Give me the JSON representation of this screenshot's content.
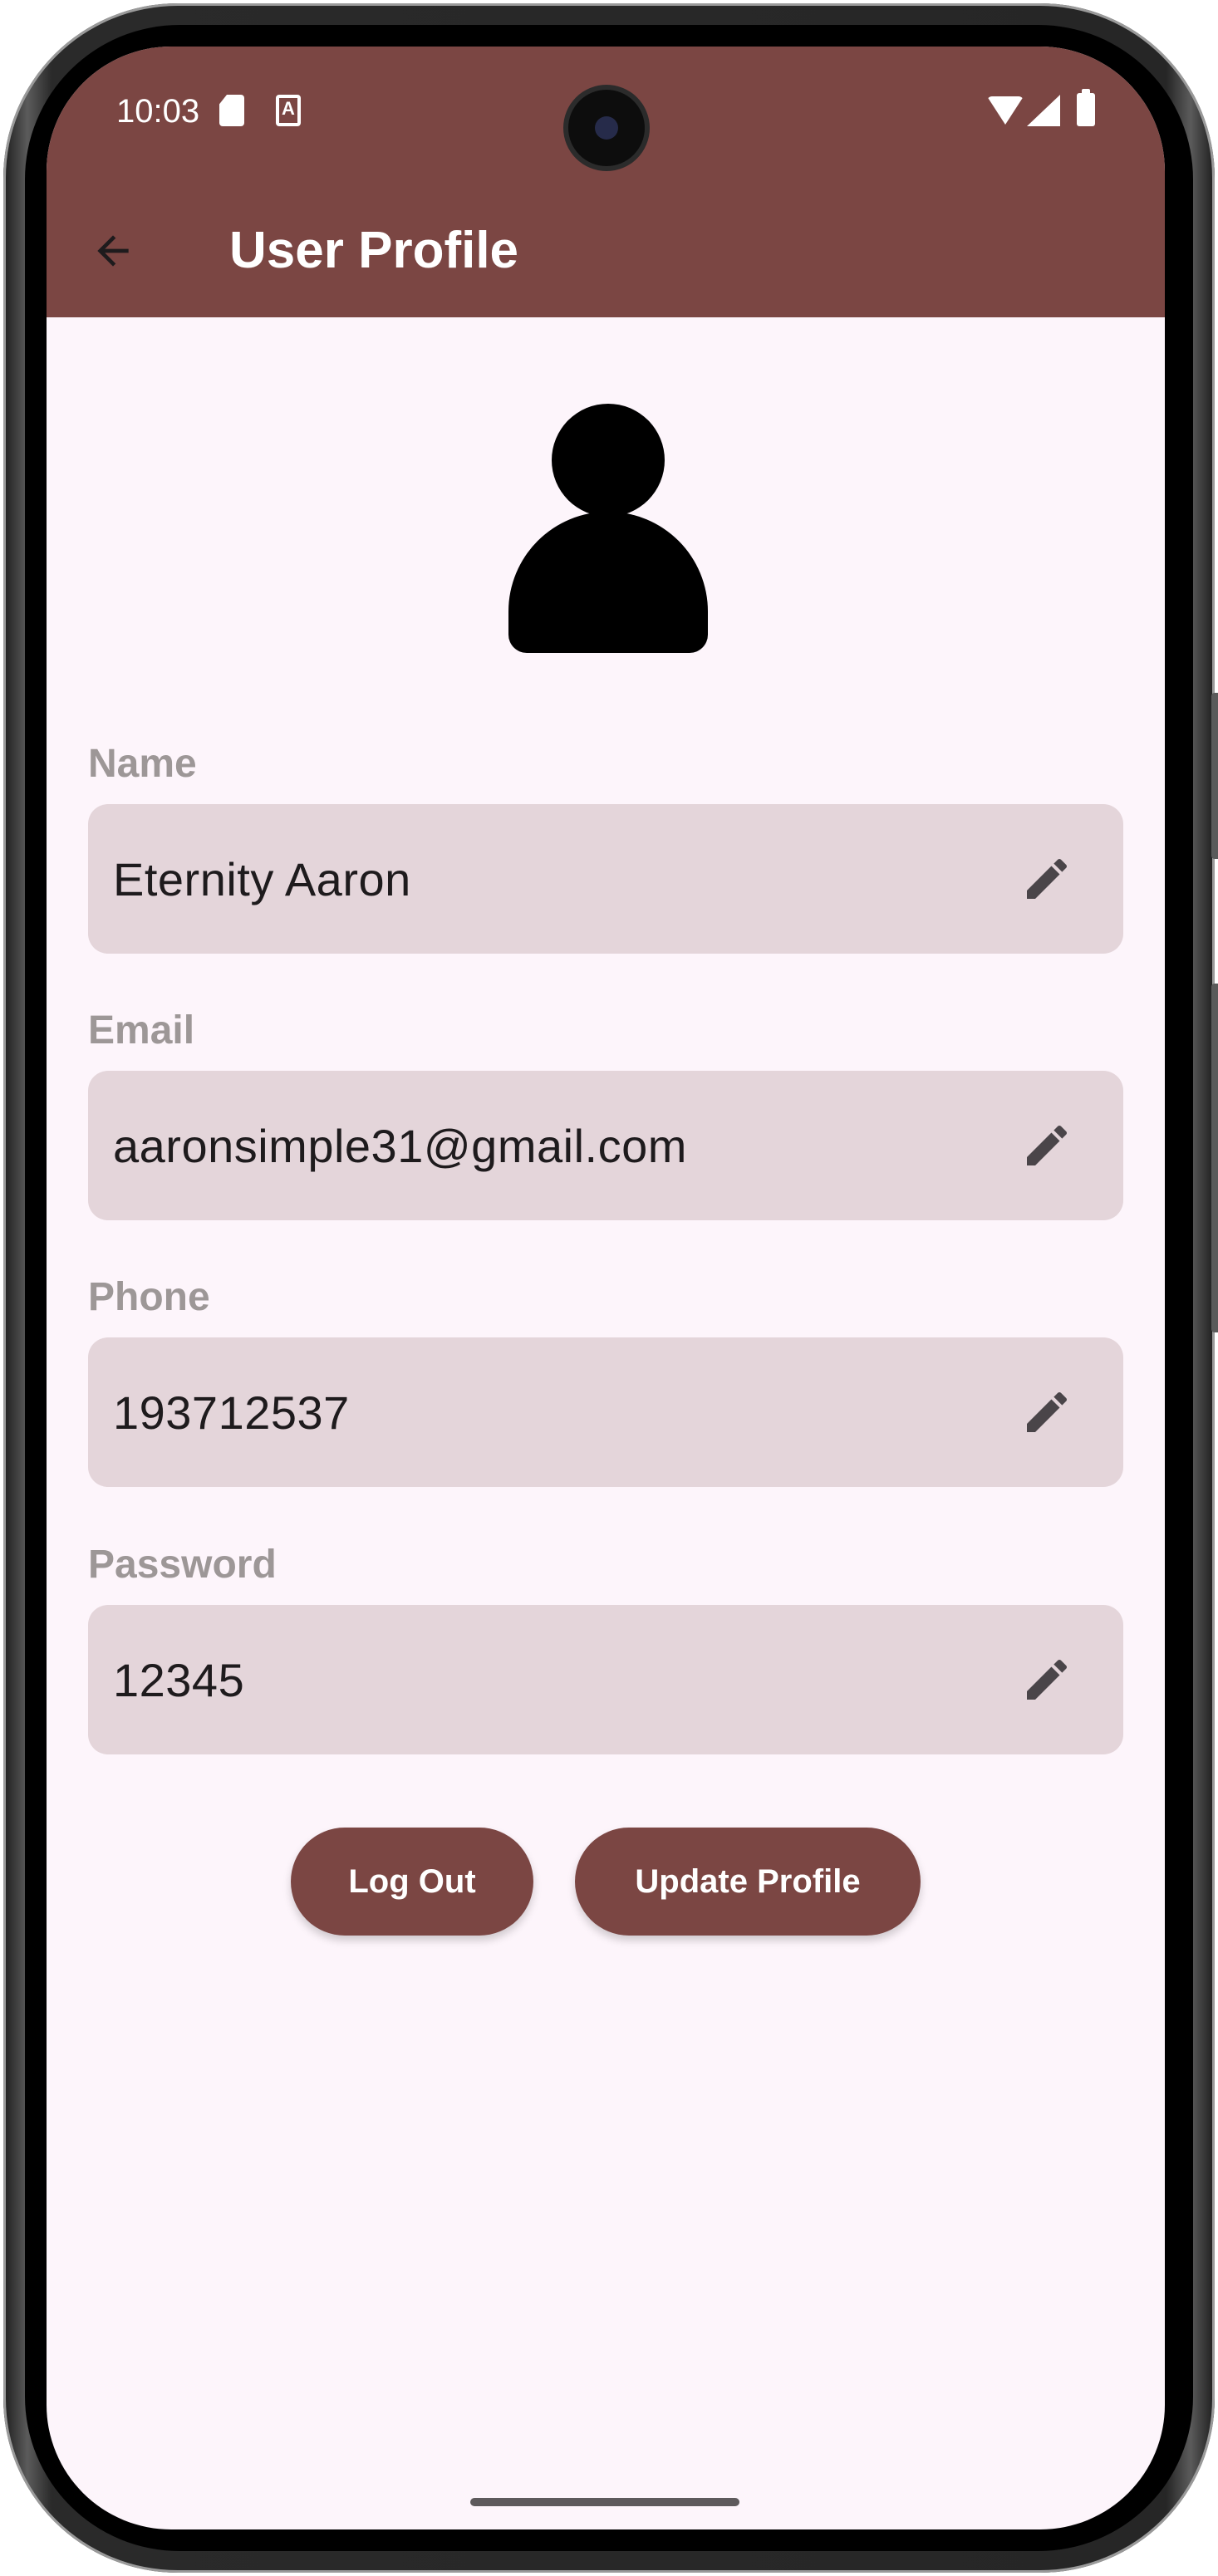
{
  "status_bar": {
    "time": "10:03"
  },
  "app_bar": {
    "title": "User Profile"
  },
  "fields": [
    {
      "label": "Name",
      "value": "Eternity Aaron"
    },
    {
      "label": "Email",
      "value": "aaronsimple31@gmail.com"
    },
    {
      "label": "Phone",
      "value": "193712537"
    },
    {
      "label": "Password",
      "value": "12345"
    }
  ],
  "actions": {
    "logout_label": "Log Out",
    "update_label": "Update Profile"
  },
  "icons": {
    "back": "arrow-left-icon",
    "avatar": "person-icon",
    "edit": "pencil-icon"
  },
  "colors": {
    "primary": "#7b4643",
    "background": "#fdf5fb",
    "field_fill": "#e4d5da",
    "label": "#9d9797"
  }
}
